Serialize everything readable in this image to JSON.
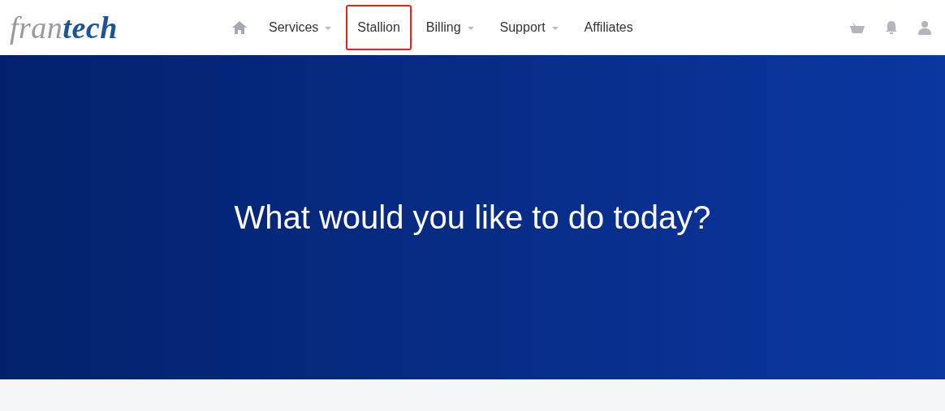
{
  "logo": "fran**tech**",
  "nav": [
    {
      "label": "Services",
      "has_menu": true,
      "highlighted": false
    },
    {
      "label": "Stallion",
      "has_menu": false,
      "highlighted": true
    },
    {
      "label": "Billing",
      "has_menu": true,
      "highlighted": false
    },
    {
      "label": "Support",
      "has_menu": true,
      "highlighted": false
    },
    {
      "label": "Affiliates",
      "has_menu": false,
      "highlighted": false
    }
  ],
  "hero": {
    "title": "What would you like to do today?"
  }
}
